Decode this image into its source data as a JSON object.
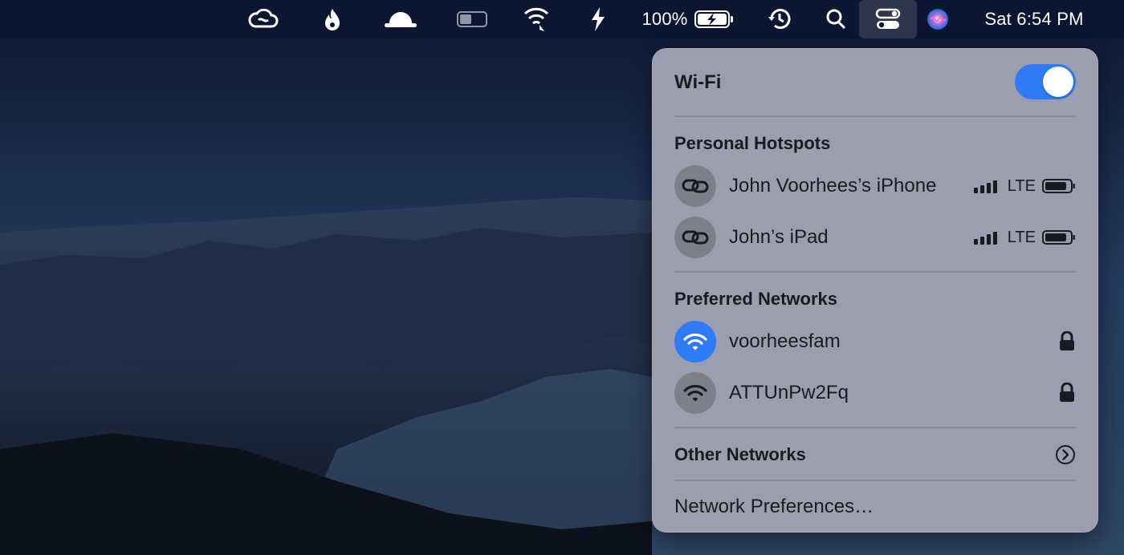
{
  "menubar": {
    "icons": [
      "creative-cloud-icon",
      "fire-icon",
      "bowler-hat-icon",
      "toggle-icon",
      "wifi-status-icon",
      "charging-lightning-icon",
      "battery-icon",
      "time-machine-icon",
      "spotlight-search-icon",
      "control-center-icon",
      "siri-icon"
    ],
    "battery_percent": "100%",
    "clock": "Sat 6:54 PM"
  },
  "wifi_panel": {
    "title": "Wi-Fi",
    "wifi_enabled": true,
    "accent_color": "#2f7bf5",
    "hotspots_header": "Personal Hotspots",
    "hotspots": [
      {
        "name": "John Voorhees’s iPhone",
        "network": "LTE",
        "icon": "personal-hotspot-icon"
      },
      {
        "name": "John’s iPad",
        "network": "LTE",
        "icon": "personal-hotspot-icon"
      }
    ],
    "preferred_header": "Preferred Networks",
    "preferred": [
      {
        "name": "voorheesfam",
        "connected": true,
        "secured": true,
        "icon": "wifi-icon"
      },
      {
        "name": "ATTUnPw2Fq",
        "connected": false,
        "secured": true,
        "icon": "wifi-icon"
      }
    ],
    "other_networks": "Other Networks",
    "network_preferences": "Network Preferences…"
  }
}
